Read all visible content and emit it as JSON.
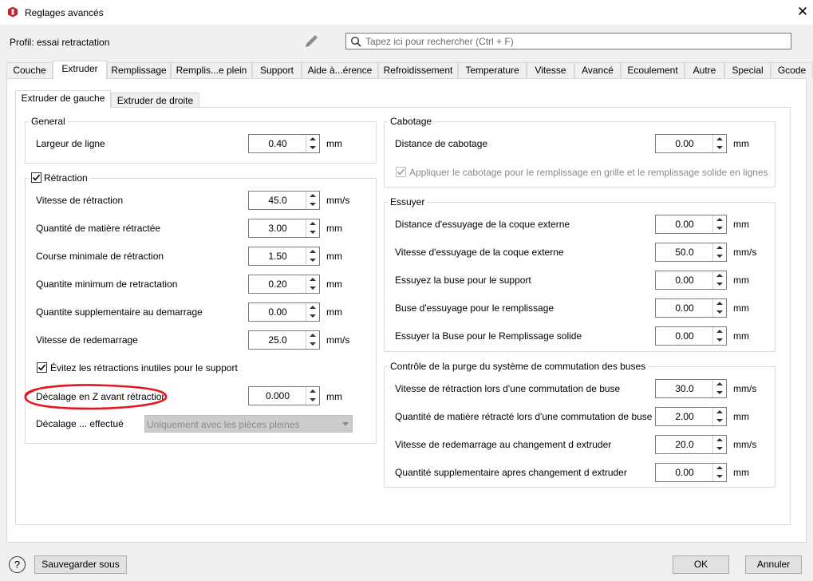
{
  "window": {
    "title": "Reglages avancés",
    "close_glyph": "✕"
  },
  "profile": {
    "label": "Profil: essai retractation"
  },
  "search": {
    "placeholder": "Tapez ici pour rechercher (Ctrl + F)"
  },
  "tabs": [
    "Couche",
    "Extruder",
    "Remplissage",
    "Remplis...e plein",
    "Support",
    "Aide à...érence",
    "Refroidissement",
    "Temperature",
    "Vitesse",
    "Avancé",
    "Ecoulement",
    "Autre",
    "Special",
    "Gcode"
  ],
  "active_tab": "Extruder",
  "subtabs": [
    "Extruder de gauche",
    "Extruder de droite"
  ],
  "general": {
    "title": "General",
    "rows": [
      {
        "label": "Largeur de ligne",
        "value": "0.40",
        "unit": "mm"
      }
    ]
  },
  "retraction": {
    "title": "Rétraction",
    "checked": true,
    "rows": [
      {
        "label": "Vitesse de rétraction",
        "value": "45.0",
        "unit": "mm/s"
      },
      {
        "label": "Quantité de matière rétractée",
        "value": "3.00",
        "unit": "mm"
      },
      {
        "label": "Course minimale de rétraction",
        "value": "1.50",
        "unit": "mm"
      },
      {
        "label": "Quantite minimum de retractation",
        "value": "0.20",
        "unit": "mm"
      },
      {
        "label": "Quantite supplementaire au demarrage",
        "value": "0.00",
        "unit": "mm"
      },
      {
        "label": "Vitesse de redemarrage",
        "value": "25.0",
        "unit": "mm/s"
      }
    ],
    "avoid_checkbox": {
      "label": "Évitez les rétractions inutiles pour le support",
      "checked": true
    },
    "z_hop": {
      "label": "Décalage en Z avant rétraction",
      "value": "0.000",
      "unit": "mm"
    },
    "z_hop_when": {
      "label": "Décalage ... effectué",
      "value": "Uniquement avec les pièces pleines"
    }
  },
  "coasting": {
    "title": "Cabotage",
    "rows": [
      {
        "label": "Distance de cabotage",
        "value": "0.00",
        "unit": "mm"
      }
    ],
    "checkbox": {
      "label": "Appliquer le cabotage pour le remplissage en grille et le remplissage solide en lignes",
      "checked": true,
      "disabled": true
    }
  },
  "wipe": {
    "title": "Essuyer",
    "rows": [
      {
        "label": "Distance d'essuyage de la coque externe",
        "value": "0.00",
        "unit": "mm"
      },
      {
        "label": "Vitesse d'essuyage de la coque externe",
        "value": "50.0",
        "unit": "mm/s"
      },
      {
        "label": "Essuyez la buse pour le support",
        "value": "0.00",
        "unit": "mm"
      },
      {
        "label": "Buse d'essuyage pour le remplissage",
        "value": "0.00",
        "unit": "mm"
      },
      {
        "label": "Essuyer la Buse pour le Remplissage solide",
        "value": "0.00",
        "unit": "mm"
      }
    ]
  },
  "purge": {
    "title": "Contrôle de la purge du système de commutation des buses",
    "rows": [
      {
        "label": "Vitesse de rétraction lors d'une commutation de buse",
        "value": "30.0",
        "unit": "mm/s"
      },
      {
        "label": "Quantité de matière rétracté lors d'une commutation de buse",
        "value": "2.00",
        "unit": "mm"
      },
      {
        "label": "Vitesse de redemarrage au changement d extruder",
        "value": "20.0",
        "unit": "mm/s"
      },
      {
        "label": "Quantité supplementaire apres changement d extruder",
        "value": "0.00",
        "unit": "mm"
      }
    ]
  },
  "footer": {
    "help": "?",
    "save_as": "Sauvegarder sous",
    "ok": "OK",
    "cancel": "Annuler"
  },
  "colors": {
    "annotation_red": "#e8141c",
    "app_icon_red": "#c0272d"
  }
}
